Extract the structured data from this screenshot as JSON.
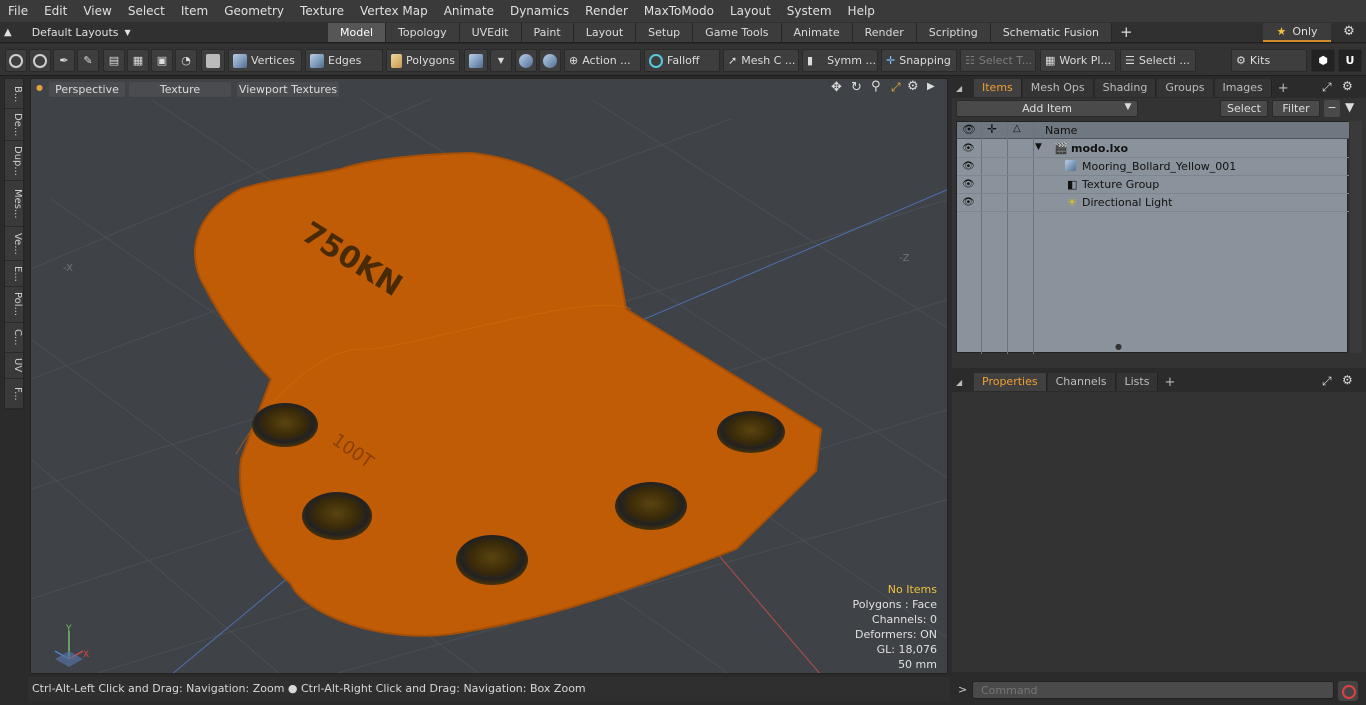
{
  "menu": [
    "File",
    "Edit",
    "View",
    "Select",
    "Item",
    "Geometry",
    "Texture",
    "Vertex Map",
    "Animate",
    "Dynamics",
    "Render",
    "MaxToModo",
    "Layout",
    "System",
    "Help"
  ],
  "layout_bar": {
    "layouts_label": "Default Layouts",
    "tabs": [
      "Model",
      "Topology",
      "UVEdit",
      "Paint",
      "Layout",
      "Setup",
      "Game Tools",
      "Animate",
      "Render",
      "Scripting",
      "Schematic Fusion"
    ],
    "active_tab": "Model",
    "add_tab": "+",
    "only_label": "Only"
  },
  "toolbar": {
    "vertices": "Vertices",
    "edges": "Edges",
    "polygons": "Polygons",
    "action": "Action ...",
    "falloff": "Falloff",
    "mesh_c": "Mesh C ...",
    "symm": "Symm ...",
    "snapping": "Snapping",
    "select_t": "Select T...",
    "work_pl": "Work Pl...",
    "selecti": "Selecti ...",
    "kits": "Kits"
  },
  "left_tabs": [
    "B...",
    "De...",
    "Dup...",
    "Mes...",
    "Ve...",
    "E...",
    "Pol...",
    "C...",
    "UV",
    "F..."
  ],
  "viewport": {
    "perspective": "Perspective",
    "texture": "Texture",
    "viewport_textures": "Viewport Textures",
    "label_750kn": "750KN",
    "label_100t": "100T",
    "axis_x": "X",
    "axis_y": "Y",
    "axis_neg_x": "-X",
    "axis_neg_z": "-Z",
    "stats": {
      "no_items": "No Items",
      "polygons": "Polygons : Face",
      "channels": "Channels: 0",
      "deformers": "Deformers: ON",
      "gl": "GL: 18,076",
      "unit": "50 mm"
    },
    "colors": {
      "background": "#3f4246",
      "bollard": "#c15c06",
      "bollard_edge": "#e06c08"
    }
  },
  "status_bar": "Ctrl-Alt-Left Click and Drag: Navigation: Zoom ● Ctrl-Alt-Right Click and Drag: Navigation: Box Zoom",
  "items_panel": {
    "tabs": [
      "Items",
      "Mesh Ops",
      "Shading",
      "Groups",
      "Images"
    ],
    "active_tab": "Items",
    "add_item": "Add Item",
    "select": "Select",
    "filter": "Filter",
    "name_header": "Name",
    "tree": [
      {
        "label": "modo.lxo",
        "indent": 0
      },
      {
        "label": "Mooring_Bollard_Yellow_001",
        "indent": 1
      },
      {
        "label": "Texture Group",
        "indent": 1
      },
      {
        "label": "Directional Light",
        "indent": 1
      }
    ]
  },
  "props_panel": {
    "tabs": [
      "Properties",
      "Channels",
      "Lists"
    ],
    "active_tab": "Properties"
  },
  "command": {
    "placeholder": "Command"
  }
}
